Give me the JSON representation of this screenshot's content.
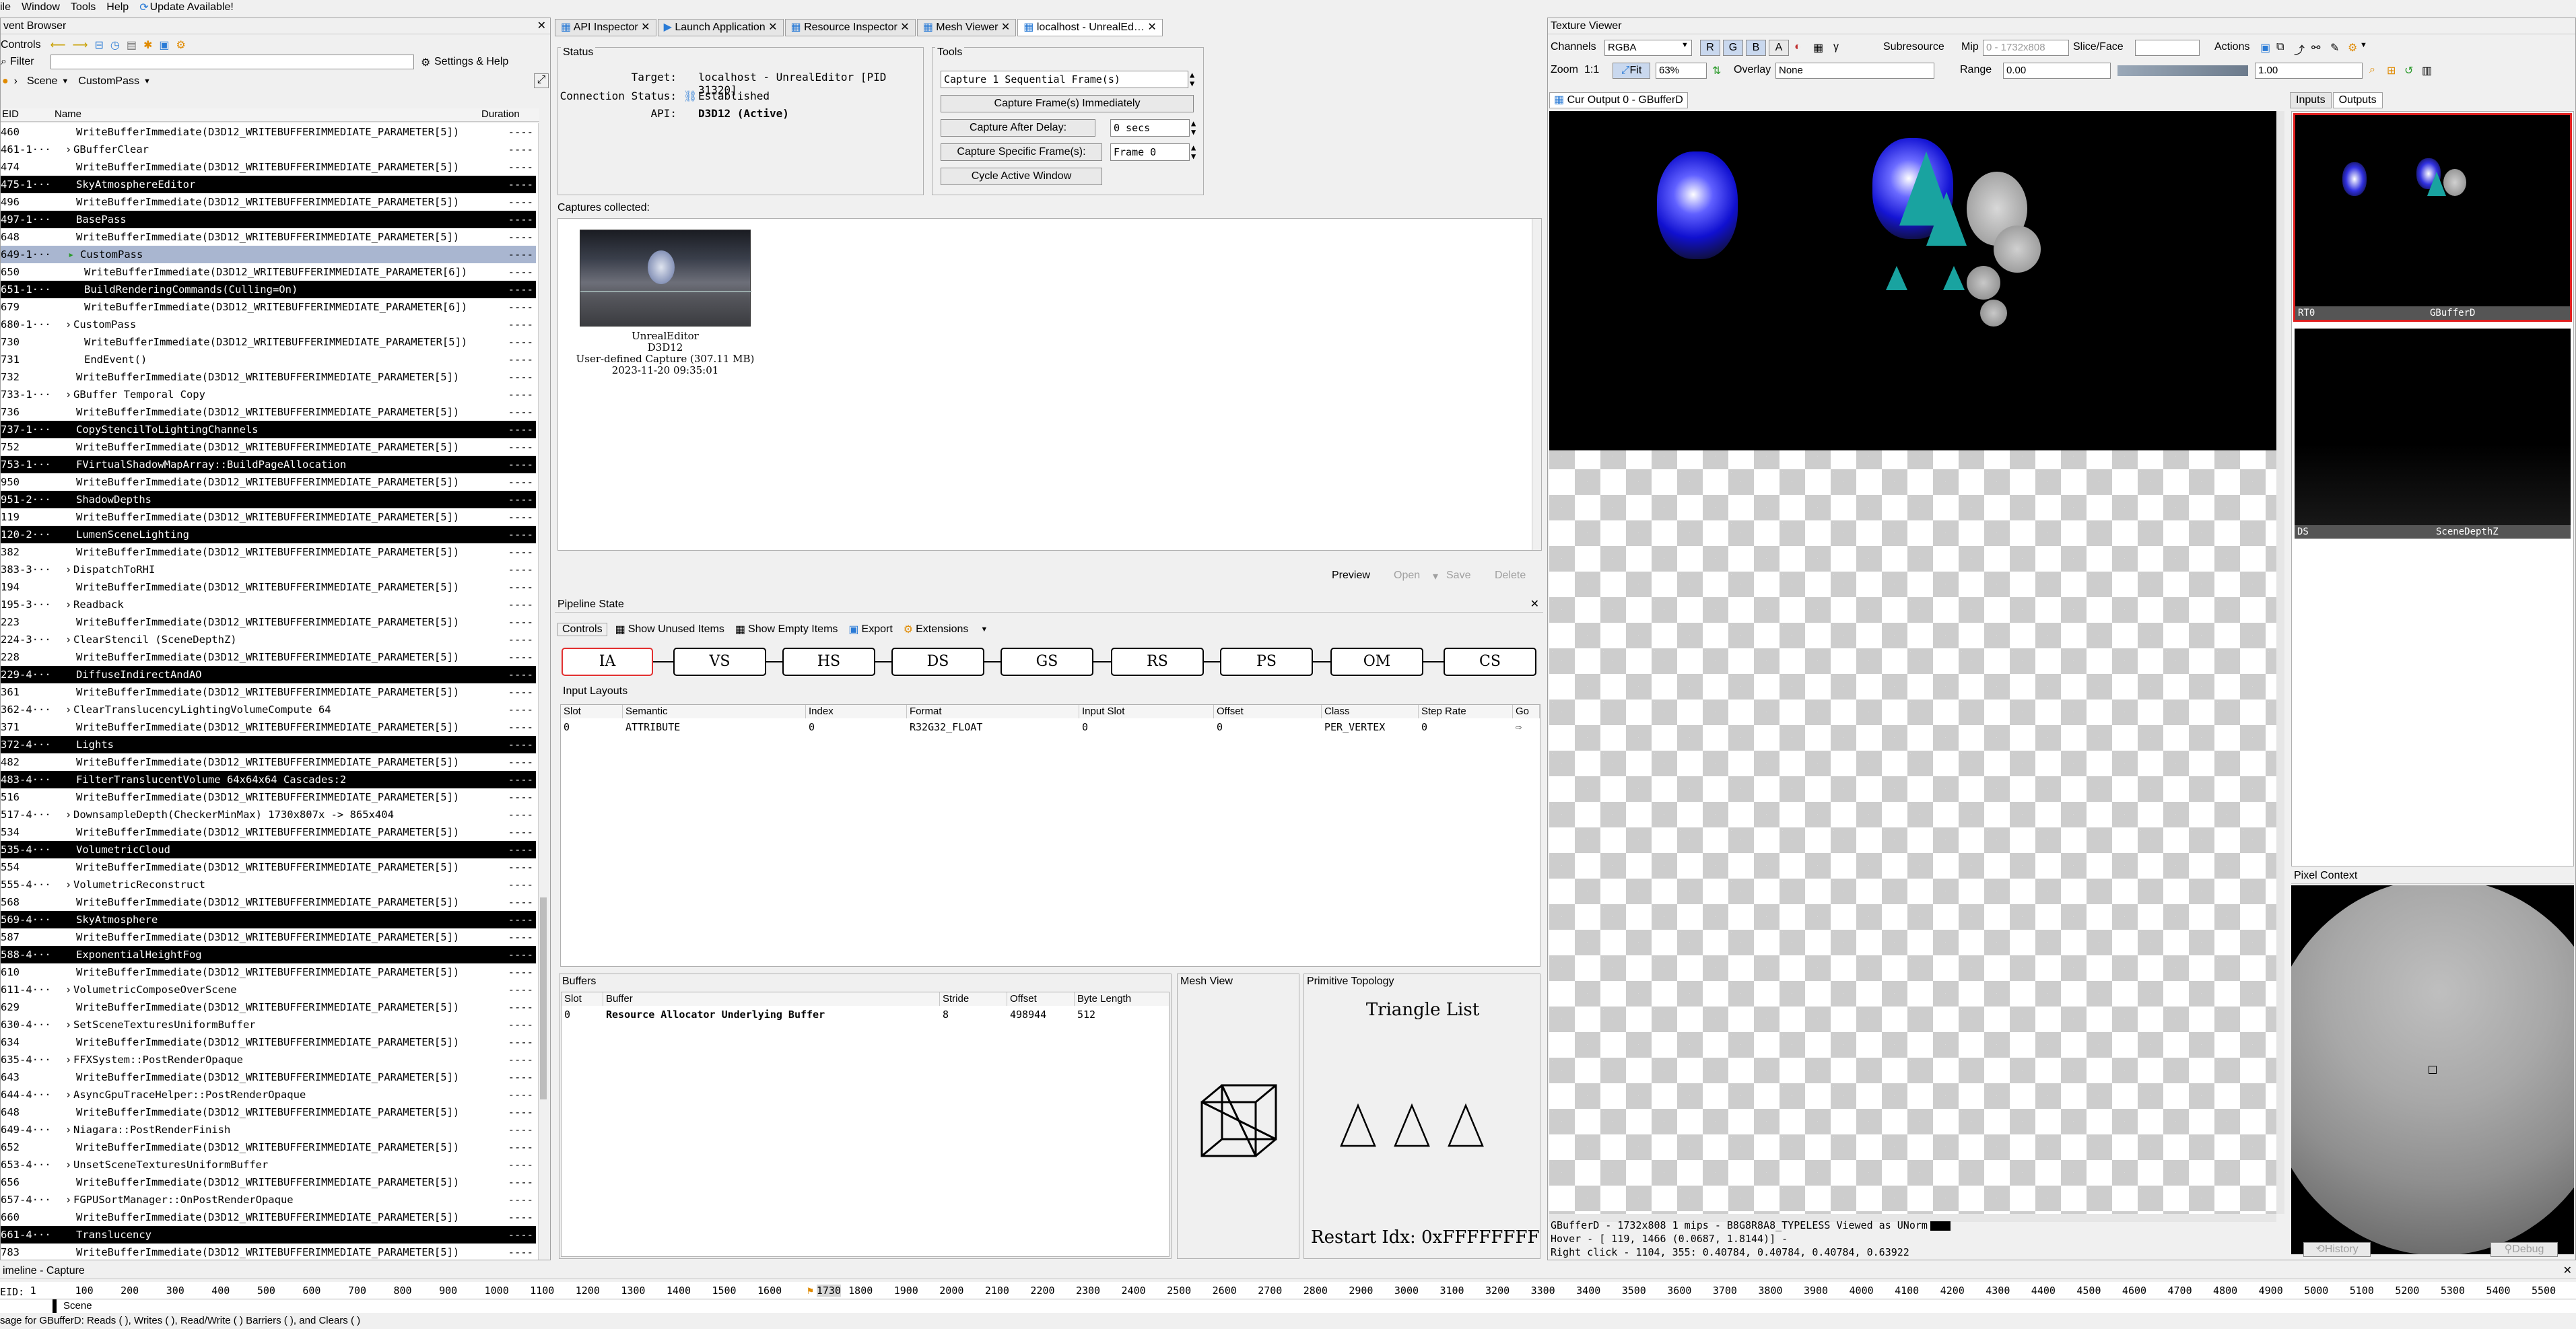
{
  "menu": {
    "file": "ile",
    "window": "Window",
    "tools": "Tools",
    "help": "Help",
    "update": "Update Available!"
  },
  "event_browser": {
    "title": "vent Browser",
    "controls_label": "Controls",
    "filter_label": "Filter",
    "settings_help": "Settings & Help",
    "breadcrumb": [
      "Scene",
      "CustomPass"
    ],
    "columns": {
      "eid": "EID",
      "name": "Name",
      "duration": "Duration"
    },
    "rows": [
      {
        "eid": "460",
        "name": "WriteBufferImmediate(D3D12_WRITEBUFFERIMMEDIATE_PARAMETER[5])",
        "dur": "----",
        "type": "normal",
        "indent": 1
      },
      {
        "eid": "461-1···",
        "name": "GBufferClear",
        "dur": "----",
        "type": "normal",
        "indent": 0,
        "expand": true
      },
      {
        "eid": "474",
        "name": "WriteBufferImmediate(D3D12_WRITEBUFFERIMMEDIATE_PARAMETER[5])",
        "dur": "----",
        "type": "normal",
        "indent": 1
      },
      {
        "eid": "475-1···",
        "name": "SkyAtmosphereEditor",
        "dur": "----",
        "type": "marker",
        "indent": 1
      },
      {
        "eid": "496",
        "name": "WriteBufferImmediate(D3D12_WRITEBUFFERIMMEDIATE_PARAMETER[5])",
        "dur": "----",
        "type": "normal",
        "indent": 1
      },
      {
        "eid": "497-1···",
        "name": "BasePass",
        "dur": "----",
        "type": "marker",
        "indent": 1
      },
      {
        "eid": "648",
        "name": "WriteBufferImmediate(D3D12_WRITEBUFFERIMMEDIATE_PARAMETER[5])",
        "dur": "----",
        "type": "normal",
        "indent": 1
      },
      {
        "eid": "649-1···",
        "name": "CustomPass",
        "dur": "----",
        "type": "sel",
        "indent": 1
      },
      {
        "eid": "650",
        "name": "WriteBufferImmediate(D3D12_WRITEBUFFERIMMEDIATE_PARAMETER[6])",
        "dur": "----",
        "type": "normal",
        "indent": 2
      },
      {
        "eid": "651-1···",
        "name": "BuildRenderingCommands(Culling=On)",
        "dur": "----",
        "type": "marker",
        "indent": 2
      },
      {
        "eid": "679",
        "name": "WriteBufferImmediate(D3D12_WRITEBUFFERIMMEDIATE_PARAMETER[6])",
        "dur": "----",
        "type": "normal",
        "indent": 2
      },
      {
        "eid": "680-1···",
        "name": "CustomPass",
        "dur": "----",
        "type": "normal",
        "indent": 1,
        "expand": true
      },
      {
        "eid": "730",
        "name": "WriteBufferImmediate(D3D12_WRITEBUFFERIMMEDIATE_PARAMETER[5])",
        "dur": "----",
        "type": "normal",
        "indent": 2
      },
      {
        "eid": "731",
        "name": "EndEvent()",
        "dur": "----",
        "type": "normal",
        "indent": 2
      },
      {
        "eid": "732",
        "name": "WriteBufferImmediate(D3D12_WRITEBUFFERIMMEDIATE_PARAMETER[5])",
        "dur": "----",
        "type": "normal",
        "indent": 1
      },
      {
        "eid": "733-1···",
        "name": "GBuffer Temporal Copy",
        "dur": "----",
        "type": "normal",
        "indent": 0,
        "expand": true
      },
      {
        "eid": "736",
        "name": "WriteBufferImmediate(D3D12_WRITEBUFFERIMMEDIATE_PARAMETER[5])",
        "dur": "----",
        "type": "normal",
        "indent": 1
      },
      {
        "eid": "737-1···",
        "name": "CopyStencilToLightingChannels",
        "dur": "----",
        "type": "marker",
        "indent": 1
      },
      {
        "eid": "752",
        "name": "WriteBufferImmediate(D3D12_WRITEBUFFERIMMEDIATE_PARAMETER[5])",
        "dur": "----",
        "type": "normal",
        "indent": 1
      },
      {
        "eid": "753-1···",
        "name": "FVirtualShadowMapArray::BuildPageAllocation",
        "dur": "----",
        "type": "marker",
        "indent": 1
      },
      {
        "eid": "950",
        "name": "WriteBufferImmediate(D3D12_WRITEBUFFERIMMEDIATE_PARAMETER[5])",
        "dur": "----",
        "type": "normal",
        "indent": 1
      },
      {
        "eid": "951-2···",
        "name": "ShadowDepths",
        "dur": "----",
        "type": "marker",
        "indent": 1
      },
      {
        "eid": "119",
        "name": "WriteBufferImmediate(D3D12_WRITEBUFFERIMMEDIATE_PARAMETER[5])",
        "dur": "----",
        "type": "normal",
        "indent": 1
      },
      {
        "eid": "120-2···",
        "name": "LumenSceneLighting",
        "dur": "----",
        "type": "marker",
        "indent": 1
      },
      {
        "eid": "382",
        "name": "WriteBufferImmediate(D3D12_WRITEBUFFERIMMEDIATE_PARAMETER[5])",
        "dur": "----",
        "type": "normal",
        "indent": 1
      },
      {
        "eid": "383-3···",
        "name": "DispatchToRHI",
        "dur": "----",
        "type": "normal",
        "indent": 0,
        "expand": true
      },
      {
        "eid": "194",
        "name": "WriteBufferImmediate(D3D12_WRITEBUFFERIMMEDIATE_PARAMETER[5])",
        "dur": "----",
        "type": "normal",
        "indent": 1
      },
      {
        "eid": "195-3···",
        "name": "Readback",
        "dur": "----",
        "type": "normal",
        "indent": 0,
        "expand": true
      },
      {
        "eid": "223",
        "name": "WriteBufferImmediate(D3D12_WRITEBUFFERIMMEDIATE_PARAMETER[5])",
        "dur": "----",
        "type": "normal",
        "indent": 1
      },
      {
        "eid": "224-3···",
        "name": "ClearStencil (SceneDepthZ)",
        "dur": "----",
        "type": "normal",
        "indent": 0,
        "expand": true
      },
      {
        "eid": "228",
        "name": "WriteBufferImmediate(D3D12_WRITEBUFFERIMMEDIATE_PARAMETER[5])",
        "dur": "----",
        "type": "normal",
        "indent": 1
      },
      {
        "eid": "229-4···",
        "name": "DiffuseIndirectAndAO",
        "dur": "----",
        "type": "marker",
        "indent": 1
      },
      {
        "eid": "361",
        "name": "WriteBufferImmediate(D3D12_WRITEBUFFERIMMEDIATE_PARAMETER[5])",
        "dur": "----",
        "type": "normal",
        "indent": 1
      },
      {
        "eid": "362-4···",
        "name": "ClearTranslucencyLightingVolumeCompute 64",
        "dur": "----",
        "type": "normal",
        "indent": 0,
        "expand": true
      },
      {
        "eid": "371",
        "name": "WriteBufferImmediate(D3D12_WRITEBUFFERIMMEDIATE_PARAMETER[5])",
        "dur": "----",
        "type": "normal",
        "indent": 1
      },
      {
        "eid": "372-4···",
        "name": "Lights",
        "dur": "----",
        "type": "marker",
        "indent": 1
      },
      {
        "eid": "482",
        "name": "WriteBufferImmediate(D3D12_WRITEBUFFERIMMEDIATE_PARAMETER[5])",
        "dur": "----",
        "type": "normal",
        "indent": 1
      },
      {
        "eid": "483-4···",
        "name": "FilterTranslucentVolume 64x64x64 Cascades:2",
        "dur": "----",
        "type": "marker",
        "indent": 1
      },
      {
        "eid": "516",
        "name": "WriteBufferImmediate(D3D12_WRITEBUFFERIMMEDIATE_PARAMETER[5])",
        "dur": "----",
        "type": "normal",
        "indent": 1
      },
      {
        "eid": "517-4···",
        "name": "DownsampleDepth(CheckerMinMax) 1730x807x -> 865x404",
        "dur": "----",
        "type": "normal",
        "indent": 0,
        "expand": true
      },
      {
        "eid": "534",
        "name": "WriteBufferImmediate(D3D12_WRITEBUFFERIMMEDIATE_PARAMETER[5])",
        "dur": "----",
        "type": "normal",
        "indent": 1
      },
      {
        "eid": "535-4···",
        "name": "VolumetricCloud",
        "dur": "----",
        "type": "marker",
        "indent": 1
      },
      {
        "eid": "554",
        "name": "WriteBufferImmediate(D3D12_WRITEBUFFERIMMEDIATE_PARAMETER[5])",
        "dur": "----",
        "type": "normal",
        "indent": 1
      },
      {
        "eid": "555-4···",
        "name": "VolumetricReconstruct",
        "dur": "----",
        "type": "normal",
        "indent": 0,
        "expand": true
      },
      {
        "eid": "568",
        "name": "WriteBufferImmediate(D3D12_WRITEBUFFERIMMEDIATE_PARAMETER[5])",
        "dur": "----",
        "type": "normal",
        "indent": 1
      },
      {
        "eid": "569-4···",
        "name": "SkyAtmosphere",
        "dur": "----",
        "type": "marker",
        "indent": 1
      },
      {
        "eid": "587",
        "name": "WriteBufferImmediate(D3D12_WRITEBUFFERIMMEDIATE_PARAMETER[5])",
        "dur": "----",
        "type": "normal",
        "indent": 1
      },
      {
        "eid": "588-4···",
        "name": "ExponentialHeightFog",
        "dur": "----",
        "type": "marker",
        "indent": 1
      },
      {
        "eid": "610",
        "name": "WriteBufferImmediate(D3D12_WRITEBUFFERIMMEDIATE_PARAMETER[5])",
        "dur": "----",
        "type": "normal",
        "indent": 1
      },
      {
        "eid": "611-4···",
        "name": "VolumetricComposeOverScene",
        "dur": "----",
        "type": "normal",
        "indent": 0,
        "expand": true
      },
      {
        "eid": "629",
        "name": "WriteBufferImmediate(D3D12_WRITEBUFFERIMMEDIATE_PARAMETER[5])",
        "dur": "----",
        "type": "normal",
        "indent": 1
      },
      {
        "eid": "630-4···",
        "name": "SetSceneTexturesUniformBuffer",
        "dur": "----",
        "type": "normal",
        "indent": 0,
        "expand": true
      },
      {
        "eid": "634",
        "name": "WriteBufferImmediate(D3D12_WRITEBUFFERIMMEDIATE_PARAMETER[5])",
        "dur": "----",
        "type": "normal",
        "indent": 1
      },
      {
        "eid": "635-4···",
        "name": "FFXSystem::PostRenderOpaque",
        "dur": "----",
        "type": "normal",
        "indent": 0,
        "expand": true
      },
      {
        "eid": "643",
        "name": "WriteBufferImmediate(D3D12_WRITEBUFFERIMMEDIATE_PARAMETER[5])",
        "dur": "----",
        "type": "normal",
        "indent": 1
      },
      {
        "eid": "644-4···",
        "name": "AsyncGpuTraceHelper::PostRenderOpaque",
        "dur": "----",
        "type": "normal",
        "indent": 0,
        "expand": true
      },
      {
        "eid": "648",
        "name": "WriteBufferImmediate(D3D12_WRITEBUFFERIMMEDIATE_PARAMETER[5])",
        "dur": "----",
        "type": "normal",
        "indent": 1
      },
      {
        "eid": "649-4···",
        "name": "Niagara::PostRenderFinish",
        "dur": "----",
        "type": "normal",
        "indent": 0,
        "expand": true
      },
      {
        "eid": "652",
        "name": "WriteBufferImmediate(D3D12_WRITEBUFFERIMMEDIATE_PARAMETER[5])",
        "dur": "----",
        "type": "normal",
        "indent": 1
      },
      {
        "eid": "653-4···",
        "name": "UnsetSceneTexturesUniformBuffer",
        "dur": "----",
        "type": "normal",
        "indent": 0,
        "expand": true
      },
      {
        "eid": "656",
        "name": "WriteBufferImmediate(D3D12_WRITEBUFFERIMMEDIATE_PARAMETER[5])",
        "dur": "----",
        "type": "normal",
        "indent": 1
      },
      {
        "eid": "657-4···",
        "name": "FGPUSortManager::OnPostRenderOpaque",
        "dur": "----",
        "type": "normal",
        "indent": 0,
        "expand": true
      },
      {
        "eid": "660",
        "name": "WriteBufferImmediate(D3D12_WRITEBUFFERIMMEDIATE_PARAMETER[5])",
        "dur": "----",
        "type": "normal",
        "indent": 1
      },
      {
        "eid": "661-4···",
        "name": "Translucency",
        "dur": "----",
        "type": "marker",
        "indent": 1
      },
      {
        "eid": "783",
        "name": "WriteBufferImmediate(D3D12_WRITEBUFFERIMMEDIATE_PARAMETER[5])",
        "dur": "----",
        "type": "normal",
        "indent": 1
      }
    ]
  },
  "tabs": [
    "API Inspector",
    "Launch Application",
    "Resource Inspector",
    "Mesh Viewer",
    "localhost - UnrealEd…"
  ],
  "status": {
    "title": "Status",
    "target_label": "Target:",
    "target_value": "localhost - UnrealEditor [PID 31320]",
    "conn_label": "Connection Status:",
    "conn_value": "Established",
    "api_label": "API:",
    "api_value": "D3D12 (Active)"
  },
  "tools": {
    "title": "Tools",
    "capture_seq": "Capture 1 Sequential Frame(s)",
    "capture_now": "Capture Frame(s) Immediately",
    "capture_delay": "Capture After Delay:",
    "delay_value": "0 secs",
    "capture_specific": "Capture Specific Frame(s):",
    "frame_value": "Frame 0",
    "cycle": "Cycle Active Window"
  },
  "captures": {
    "label": "Captures collected:",
    "item": {
      "app": "UnrealEditor",
      "api": "D3D12",
      "desc": "User-defined Capture (307.11 MB)",
      "date": "2023-11-20 09:35:01"
    },
    "buttons": {
      "preview": "Preview",
      "open": "Open",
      "save": "Save",
      "delete": "Delete"
    }
  },
  "pipeline": {
    "title": "Pipeline State",
    "toolbar": {
      "controls": "Controls",
      "show_unused": "Show Unused Items",
      "show_empty": "Show Empty Items",
      "export": "Export",
      "extensions": "Extensions"
    },
    "stages": [
      "IA",
      "VS",
      "HS",
      "DS",
      "GS",
      "RS",
      "PS",
      "OM",
      "CS"
    ],
    "input_layouts": {
      "title": "Input Layouts",
      "columns": [
        "Slot",
        "Semantic",
        "Index",
        "Format",
        "Input Slot",
        "Offset",
        "Class",
        "Step Rate",
        "Go"
      ],
      "rows": [
        [
          "0",
          "ATTRIBUTE",
          "0",
          "R32G32_FLOAT",
          "0",
          "0",
          "PER_VERTEX",
          "0",
          ""
        ]
      ]
    },
    "buffers": {
      "title": "Buffers",
      "columns": [
        "Slot",
        "Buffer",
        "Stride",
        "Offset",
        "Byte Length",
        "Go"
      ],
      "rows": [
        [
          "0",
          "Resource Allocator Underlying Buffer",
          "8",
          "498944",
          "512",
          ""
        ]
      ]
    },
    "mesh_view": "Mesh View",
    "topology": {
      "title": "Primitive Topology",
      "value": "Triangle List",
      "restart": "Restart Idx: 0xFFFFFFFF"
    }
  },
  "texture_viewer": {
    "title": "Texture Viewer",
    "channels_label": "Channels",
    "channels_value": "RGBA",
    "channel_btns": [
      "R",
      "G",
      "B",
      "A"
    ],
    "subresource": "Subresource",
    "mip_label": "Mip",
    "mip_value": "0 - 1732x808",
    "slice_label": "Slice/Face",
    "actions": "Actions",
    "zoom_label": "Zoom",
    "zoom_11": "1:1",
    "fit": "Fit",
    "zoom_value": "63%",
    "overlay_label": "Overlay",
    "overlay_value": "None",
    "range_label": "Range",
    "range_min": "0.00",
    "range_max": "1.00",
    "tab": "Cur Output 0 - GBufferD",
    "status1": "GBufferD - 1732x808 1 mips - B8G8R8A8_TYPELESS Viewed as UNorm",
    "status2": "Hover - [ 119, 1466 (0.0687, 1.8144)] -",
    "status3": "Right click - 1104,  355: 0.40784, 0.40784, 0.40784, 0.63922",
    "side_tabs": [
      "Inputs",
      "Outputs"
    ],
    "thumb1_left": "RT0",
    "thumb1_right": "GBufferD",
    "thumb2_left": "DS",
    "thumb2_right": "SceneDepthZ",
    "pixel_context": "Pixel Context",
    "history": "History",
    "debug": "Debug"
  },
  "timeline": {
    "title": "imeline - Capture",
    "eid_label": "EID:",
    "ticks": [
      "1",
      "100",
      "200",
      "300",
      "400",
      "500",
      "600",
      "700",
      "800",
      "900",
      "1000",
      "1100",
      "1200",
      "1300",
      "1400",
      "1500",
      "1600",
      "1730",
      "1800",
      "1900",
      "2000",
      "2100",
      "2200",
      "2300",
      "2400",
      "2500",
      "2600",
      "2700",
      "2800",
      "2900",
      "3000",
      "3100",
      "3200",
      "3300",
      "3400",
      "3500",
      "3600",
      "3700",
      "3800",
      "3900",
      "4000",
      "4100",
      "4200",
      "4300",
      "4400",
      "4500",
      "4600",
      "4700",
      "4800",
      "4900",
      "5000",
      "5100",
      "5200",
      "5300",
      "5400",
      "5500"
    ],
    "scene": "Scene",
    "usage": "sage for GBufferD: Reads (  ), Writes (  ), Read/Write (  ) Barriers (  ), and Clears (  )"
  },
  "colors": {
    "marker_bg": "#000000",
    "selected_bg": "#a9b6d0",
    "active_stage": "#e23030",
    "thumb_border": "#e02020"
  }
}
